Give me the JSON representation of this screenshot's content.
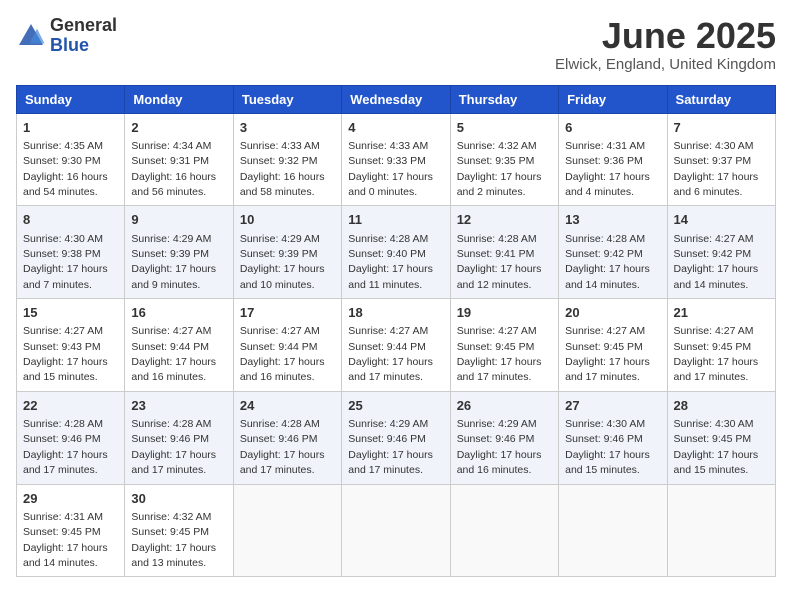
{
  "header": {
    "logo_general": "General",
    "logo_blue": "Blue",
    "month_title": "June 2025",
    "location": "Elwick, England, United Kingdom"
  },
  "days_of_week": [
    "Sunday",
    "Monday",
    "Tuesday",
    "Wednesday",
    "Thursday",
    "Friday",
    "Saturday"
  ],
  "weeks": [
    [
      {
        "day": "1",
        "sunrise": "4:35 AM",
        "sunset": "9:30 PM",
        "daylight": "16 hours and 54 minutes."
      },
      {
        "day": "2",
        "sunrise": "4:34 AM",
        "sunset": "9:31 PM",
        "daylight": "16 hours and 56 minutes."
      },
      {
        "day": "3",
        "sunrise": "4:33 AM",
        "sunset": "9:32 PM",
        "daylight": "16 hours and 58 minutes."
      },
      {
        "day": "4",
        "sunrise": "4:33 AM",
        "sunset": "9:33 PM",
        "daylight": "17 hours and 0 minutes."
      },
      {
        "day": "5",
        "sunrise": "4:32 AM",
        "sunset": "9:35 PM",
        "daylight": "17 hours and 2 minutes."
      },
      {
        "day": "6",
        "sunrise": "4:31 AM",
        "sunset": "9:36 PM",
        "daylight": "17 hours and 4 minutes."
      },
      {
        "day": "7",
        "sunrise": "4:30 AM",
        "sunset": "9:37 PM",
        "daylight": "17 hours and 6 minutes."
      }
    ],
    [
      {
        "day": "8",
        "sunrise": "4:30 AM",
        "sunset": "9:38 PM",
        "daylight": "17 hours and 7 minutes."
      },
      {
        "day": "9",
        "sunrise": "4:29 AM",
        "sunset": "9:39 PM",
        "daylight": "17 hours and 9 minutes."
      },
      {
        "day": "10",
        "sunrise": "4:29 AM",
        "sunset": "9:39 PM",
        "daylight": "17 hours and 10 minutes."
      },
      {
        "day": "11",
        "sunrise": "4:28 AM",
        "sunset": "9:40 PM",
        "daylight": "17 hours and 11 minutes."
      },
      {
        "day": "12",
        "sunrise": "4:28 AM",
        "sunset": "9:41 PM",
        "daylight": "17 hours and 12 minutes."
      },
      {
        "day": "13",
        "sunrise": "4:28 AM",
        "sunset": "9:42 PM",
        "daylight": "17 hours and 14 minutes."
      },
      {
        "day": "14",
        "sunrise": "4:27 AM",
        "sunset": "9:42 PM",
        "daylight": "17 hours and 14 minutes."
      }
    ],
    [
      {
        "day": "15",
        "sunrise": "4:27 AM",
        "sunset": "9:43 PM",
        "daylight": "17 hours and 15 minutes."
      },
      {
        "day": "16",
        "sunrise": "4:27 AM",
        "sunset": "9:44 PM",
        "daylight": "17 hours and 16 minutes."
      },
      {
        "day": "17",
        "sunrise": "4:27 AM",
        "sunset": "9:44 PM",
        "daylight": "17 hours and 16 minutes."
      },
      {
        "day": "18",
        "sunrise": "4:27 AM",
        "sunset": "9:44 PM",
        "daylight": "17 hours and 17 minutes."
      },
      {
        "day": "19",
        "sunrise": "4:27 AM",
        "sunset": "9:45 PM",
        "daylight": "17 hours and 17 minutes."
      },
      {
        "day": "20",
        "sunrise": "4:27 AM",
        "sunset": "9:45 PM",
        "daylight": "17 hours and 17 minutes."
      },
      {
        "day": "21",
        "sunrise": "4:27 AM",
        "sunset": "9:45 PM",
        "daylight": "17 hours and 17 minutes."
      }
    ],
    [
      {
        "day": "22",
        "sunrise": "4:28 AM",
        "sunset": "9:46 PM",
        "daylight": "17 hours and 17 minutes."
      },
      {
        "day": "23",
        "sunrise": "4:28 AM",
        "sunset": "9:46 PM",
        "daylight": "17 hours and 17 minutes."
      },
      {
        "day": "24",
        "sunrise": "4:28 AM",
        "sunset": "9:46 PM",
        "daylight": "17 hours and 17 minutes."
      },
      {
        "day": "25",
        "sunrise": "4:29 AM",
        "sunset": "9:46 PM",
        "daylight": "17 hours and 17 minutes."
      },
      {
        "day": "26",
        "sunrise": "4:29 AM",
        "sunset": "9:46 PM",
        "daylight": "17 hours and 16 minutes."
      },
      {
        "day": "27",
        "sunrise": "4:30 AM",
        "sunset": "9:46 PM",
        "daylight": "17 hours and 15 minutes."
      },
      {
        "day": "28",
        "sunrise": "4:30 AM",
        "sunset": "9:45 PM",
        "daylight": "17 hours and 15 minutes."
      }
    ],
    [
      {
        "day": "29",
        "sunrise": "4:31 AM",
        "sunset": "9:45 PM",
        "daylight": "17 hours and 14 minutes."
      },
      {
        "day": "30",
        "sunrise": "4:32 AM",
        "sunset": "9:45 PM",
        "daylight": "17 hours and 13 minutes."
      },
      null,
      null,
      null,
      null,
      null
    ]
  ]
}
